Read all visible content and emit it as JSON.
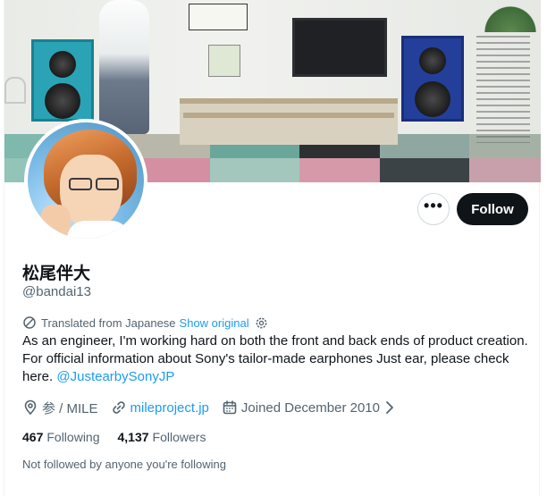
{
  "profile": {
    "display_name": "松尾伴大",
    "handle": "@bandai13",
    "translation": {
      "label": "Translated from Japanese",
      "show_original": "Show original"
    },
    "bio": {
      "text": "As an engineer, I'm working hard on both the front and back ends of product creation. For official information about Sony's tailor-made earphones Just ear, please check here.",
      "mention": "@JustearbySonyJP"
    },
    "location": "参 / MILE",
    "website": "mileproject.jp",
    "joined": "Joined December 2010",
    "following": {
      "count": "467",
      "label": "Following"
    },
    "followers": {
      "count": "4,137",
      "label": "Followers"
    },
    "not_followed_text": "Not followed by anyone you're following"
  },
  "actions": {
    "more_label": "•••",
    "follow_label": "Follow"
  },
  "icons": {
    "more": "more-dots-icon",
    "translate": "translate-icon",
    "settings": "gear-icon",
    "location": "location-pin-icon",
    "link": "link-icon",
    "calendar": "calendar-icon",
    "chevron": "chevron-right-icon"
  },
  "colors": {
    "accent": "#1d9bf0",
    "text_primary": "#0f1419",
    "text_secondary": "#536471",
    "follow_button_bg": "#0f1419"
  }
}
